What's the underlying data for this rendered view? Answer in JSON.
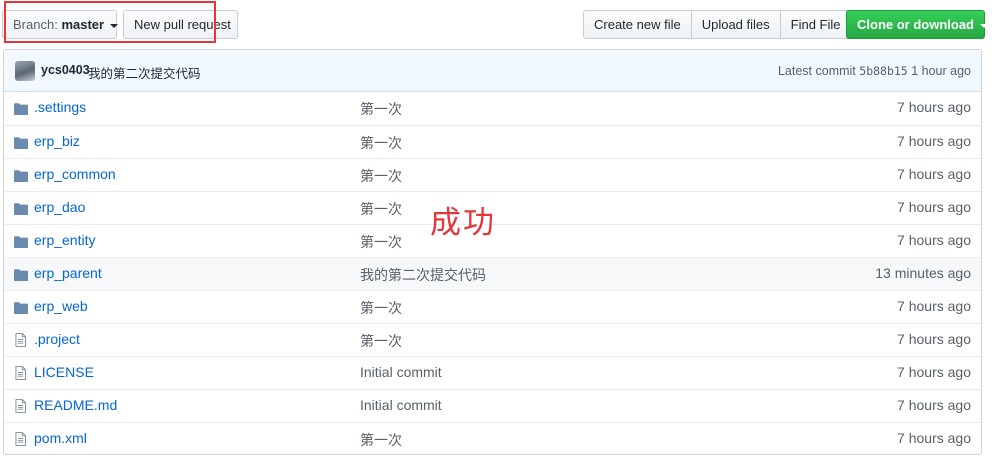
{
  "toolbar": {
    "branch_prefix": "Branch:",
    "branch_value": "master",
    "new_pr": "New pull request",
    "create_file": "Create new file",
    "upload_files": "Upload files",
    "find_file": "Find File",
    "clone": "Clone or download"
  },
  "commit": {
    "author": "ycs0403",
    "message": "我的第二次提交代码",
    "latest_label": "Latest commit",
    "sha": "5b88b15",
    "age": "1 hour ago"
  },
  "files": [
    {
      "type": "folder",
      "name": ".settings",
      "message": "第一次",
      "age": "7 hours ago"
    },
    {
      "type": "folder",
      "name": "erp_biz",
      "message": "第一次",
      "age": "7 hours ago"
    },
    {
      "type": "folder",
      "name": "erp_common",
      "message": "第一次",
      "age": "7 hours ago"
    },
    {
      "type": "folder",
      "name": "erp_dao",
      "message": "第一次",
      "age": "7 hours ago"
    },
    {
      "type": "folder",
      "name": "erp_entity",
      "message": "第一次",
      "age": "7 hours ago"
    },
    {
      "type": "folder",
      "name": "erp_parent",
      "message": "我的第二次提交代码",
      "age": "13 minutes ago"
    },
    {
      "type": "folder",
      "name": "erp_web",
      "message": "第一次",
      "age": "7 hours ago"
    },
    {
      "type": "file",
      "name": ".project",
      "message": "第一次",
      "age": "7 hours ago"
    },
    {
      "type": "file",
      "name": "LICENSE",
      "message": "Initial commit",
      "age": "7 hours ago"
    },
    {
      "type": "file",
      "name": "README.md",
      "message": "Initial commit",
      "age": "7 hours ago"
    },
    {
      "type": "file",
      "name": "pom.xml",
      "message": "第一次",
      "age": "7 hours ago"
    }
  ],
  "annotation": {
    "text": "成功",
    "color": "#e5353a"
  }
}
